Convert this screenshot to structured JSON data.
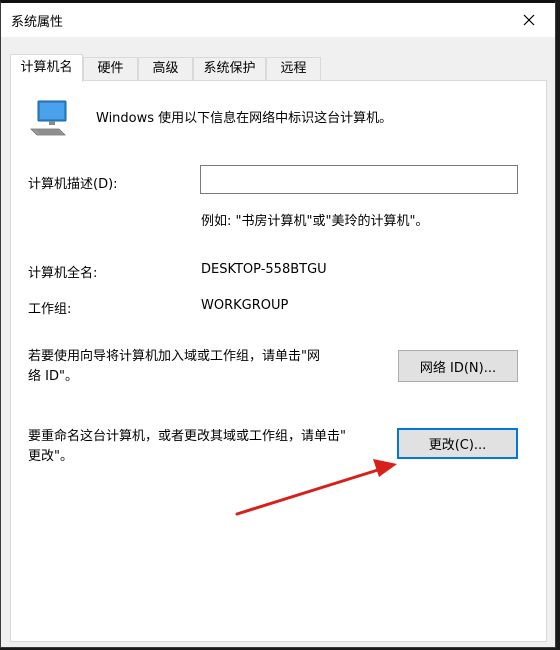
{
  "window": {
    "title": "系统属性"
  },
  "tabs": [
    {
      "label": "计算机名",
      "active": true
    },
    {
      "label": "硬件",
      "active": false
    },
    {
      "label": "高级",
      "active": false
    },
    {
      "label": "系统保护",
      "active": false
    },
    {
      "label": "远程",
      "active": false
    }
  ],
  "main": {
    "intro": "Windows 使用以下信息在网络中标识这台计算机。",
    "description_label": "计算机描述(D):",
    "description_value": "",
    "description_placeholder": "",
    "example": "例如: \"书房计算机\"或\"美玲的计算机\"。",
    "full_name_label": "计算机全名:",
    "full_name_value": "DESKTOP-558BTGU",
    "workgroup_label": "工作组:",
    "workgroup_value": "WORKGROUP",
    "network_text_line1": "若要使用向导将计算机加入域或工作组，请单击\"网",
    "network_text_line2": "络 ID\"。",
    "network_button": "网络 ID(N)...",
    "rename_text_line1": "要重命名这台计算机，或者更改其域或工作组，请单击\"",
    "rename_text_line2": "更改\"。",
    "change_button": "更改(C)..."
  },
  "colors": {
    "arrow": "#d8201a",
    "focus": "#0078d7"
  },
  "icons": {
    "computer": "computer-icon",
    "close": "close-icon"
  }
}
